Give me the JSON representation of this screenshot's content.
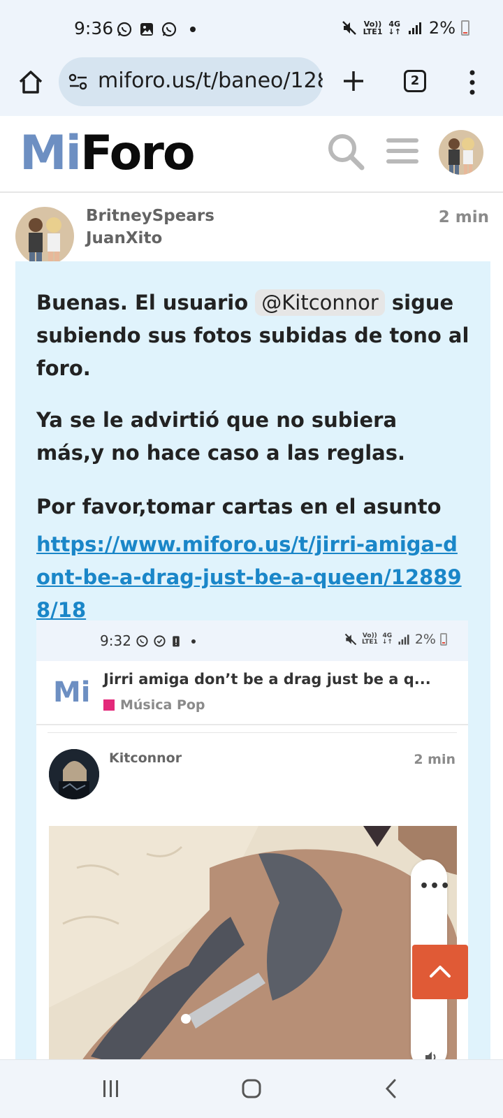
{
  "status_bar": {
    "time": "9:36",
    "network_top": "Vo))",
    "network_bottom": "LTE1",
    "net_type": "4G",
    "battery": "2%"
  },
  "browser": {
    "url": "miforo.us/t/baneo/128",
    "tab_count": "2"
  },
  "site": {
    "logo_mi": "Mi",
    "logo_foro": "Foro"
  },
  "post": {
    "user_primary": "BritneySpears",
    "user_secondary": "JuanXito",
    "time": "2 min",
    "para1_before": "Buenas. El usuario ",
    "mention": "@Kitconnor",
    "para1_after": " sigue subiendo sus fotos subidas de tono al foro.",
    "para2": "Ya se le advirtió que no subiera más,y no hace caso a las reglas.",
    "para3": "Por favor,tomar cartas en el asunto",
    "link": "https://www.miforo.us/t/jirri-amiga-dont-be-a-drag-just-be-a-queen/128898/18"
  },
  "embedded": {
    "time": "9:32",
    "battery": "2%",
    "network_top": "Vo))",
    "network_bottom": "LTE1",
    "net_type": "4G",
    "logo": "Mi",
    "topic_title": "Jirri amiga don’t be a drag just be a q...",
    "category": "Música Pop",
    "category_color": "#e3297a",
    "user": "Kitconnor",
    "time_ago": "2 min"
  },
  "floating": {
    "more_label": "•••"
  },
  "colors": {
    "brand_blue": "#6d8fc2",
    "link": "#1a86c8",
    "post_bg": "#e0f3fc",
    "scroll_top_button": "#e05a36"
  }
}
